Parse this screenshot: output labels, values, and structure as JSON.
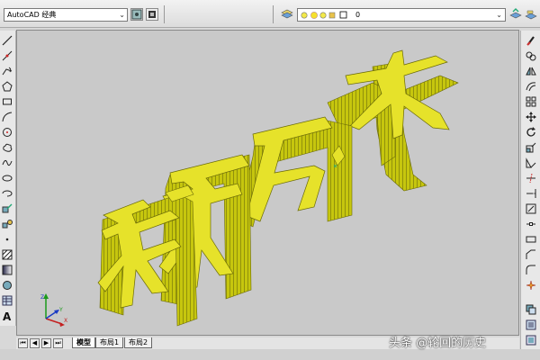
{
  "toolbar": {
    "workspace_value": "AutoCAD 经典",
    "layer_value": "0"
  },
  "tabs": [
    {
      "label": "模型",
      "active": true
    },
    {
      "label": "布局1",
      "active": false
    },
    {
      "label": "布局2",
      "active": false
    }
  ],
  "watermark": "头条 @轮回的历史",
  "colors": {
    "extrusion_face": "#c6c60e",
    "extrusion_top": "#e6e22a",
    "extrusion_lines": "#7a7a0a",
    "viewport_bg": "#c9c9c9"
  },
  "icons": {
    "left_toolbar": [
      "line-icon",
      "construction-line-icon",
      "polyline-icon",
      "polygon-icon",
      "rectangle-icon",
      "arc-icon",
      "circle-icon",
      "revision-cloud-icon",
      "spline-icon",
      "ellipse-icon",
      "ellipse-arc-icon",
      "insert-block-icon",
      "make-block-icon",
      "point-icon",
      "hatch-icon",
      "gradient-icon",
      "region-icon",
      "table-icon",
      "multiline-text-icon"
    ],
    "right_toolbar": [
      "erase-icon",
      "copy-icon",
      "mirror-icon",
      "offset-icon",
      "array-icon",
      "move-icon",
      "rotate-icon",
      "scale-icon",
      "stretch-icon",
      "trim-icon",
      "extend-icon",
      "break-at-point-icon",
      "break-icon",
      "join-icon",
      "chamfer-icon",
      "fillet-icon",
      "explode-icon"
    ]
  }
}
